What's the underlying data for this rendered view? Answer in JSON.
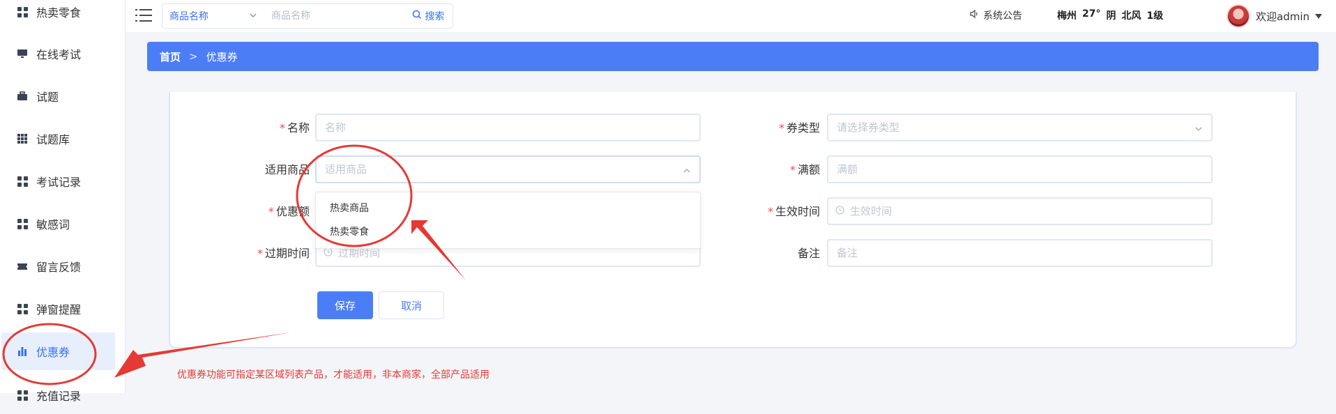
{
  "sidebar": {
    "items": [
      {
        "label": "热卖零食",
        "icon": "grid-icon",
        "active": false
      },
      {
        "label": "在线考试",
        "icon": "monitor-icon",
        "active": false
      },
      {
        "label": "试题",
        "icon": "briefcase-icon",
        "active": false
      },
      {
        "label": "试题库",
        "icon": "apps-icon",
        "active": false
      },
      {
        "label": "考试记录",
        "icon": "grid-icon",
        "active": false
      },
      {
        "label": "敏感词",
        "icon": "grid-icon",
        "active": false
      },
      {
        "label": "留言反馈",
        "icon": "ticket-icon",
        "active": false
      },
      {
        "label": "弹窗提醒",
        "icon": "grid-icon",
        "active": false
      },
      {
        "label": "优惠券",
        "icon": "bar-chart-icon",
        "active": true
      },
      {
        "label": "充值记录",
        "icon": "grid-icon",
        "active": false
      }
    ]
  },
  "header": {
    "search_select_value": "商品名称",
    "search_placeholder": "商品名称",
    "search_button": "搜索",
    "notice_label": "系统公告",
    "weather": {
      "city": "梅州",
      "temp": "27°",
      "condition": "阴",
      "wind": "北风",
      "level": "1级"
    },
    "user_greeting": "欢迎admin"
  },
  "breadcrumb": {
    "home": "首页",
    "separator": ">",
    "current": "优惠券"
  },
  "form": {
    "name": {
      "label": "名称",
      "placeholder": "名称",
      "required": true
    },
    "coupon_type": {
      "label": "券类型",
      "placeholder": "请选择券类型",
      "required": true
    },
    "applicable_goods": {
      "label": "适用商品",
      "placeholder": "适用商品",
      "required": false,
      "options": [
        "热卖商品",
        "热卖零食"
      ]
    },
    "full_amount": {
      "label": "满额",
      "placeholder": "满额",
      "required": true
    },
    "discount_amount": {
      "label": "优惠额",
      "required": true
    },
    "effective_time": {
      "label": "生效时间",
      "placeholder": "生效时间",
      "required": true
    },
    "expire_time": {
      "label": "过期时间",
      "placeholder": "过期时间",
      "required": true
    },
    "remark": {
      "label": "备注",
      "placeholder": "备注",
      "required": false
    },
    "save_label": "保存",
    "cancel_label": "取消"
  },
  "annotation": {
    "note": "优惠券功能可指定某区域列表产品，才能适用，非本商家，全部产品适用",
    "color": "#e53935"
  },
  "colors": {
    "accent": "#4b7ef6",
    "required": "#f04a4a"
  }
}
